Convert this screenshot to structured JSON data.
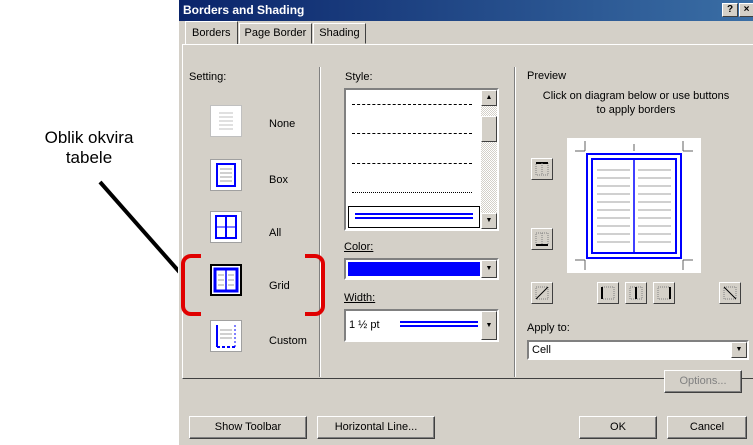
{
  "callout": {
    "line1": "Oblik okvira",
    "line2": "tabele"
  },
  "dialog": {
    "title": "Borders and Shading",
    "help_btn": "?",
    "close_btn": "×",
    "tabs": [
      "Borders",
      "Page Border",
      "Shading"
    ],
    "setting_label": "Setting:",
    "settings": [
      "None",
      "Box",
      "All",
      "Grid",
      "Custom"
    ],
    "style_label": "Style:",
    "color_label": "Color:",
    "width_label": "Width:",
    "width_value": "1 ½ pt",
    "preview_label": "Preview",
    "preview_hint": "Click on diagram below or use buttons to apply borders",
    "apply_label": "Apply to:",
    "apply_value": "Cell",
    "options_btn": "Options...",
    "show_toolbar_btn": "Show Toolbar",
    "hline_btn": "Horizontal Line...",
    "ok_btn": "OK",
    "cancel_btn": "Cancel"
  },
  "colors": {
    "accent": "#0000ff",
    "callout_red": "#e00000",
    "title_bar": "#0a246a"
  }
}
